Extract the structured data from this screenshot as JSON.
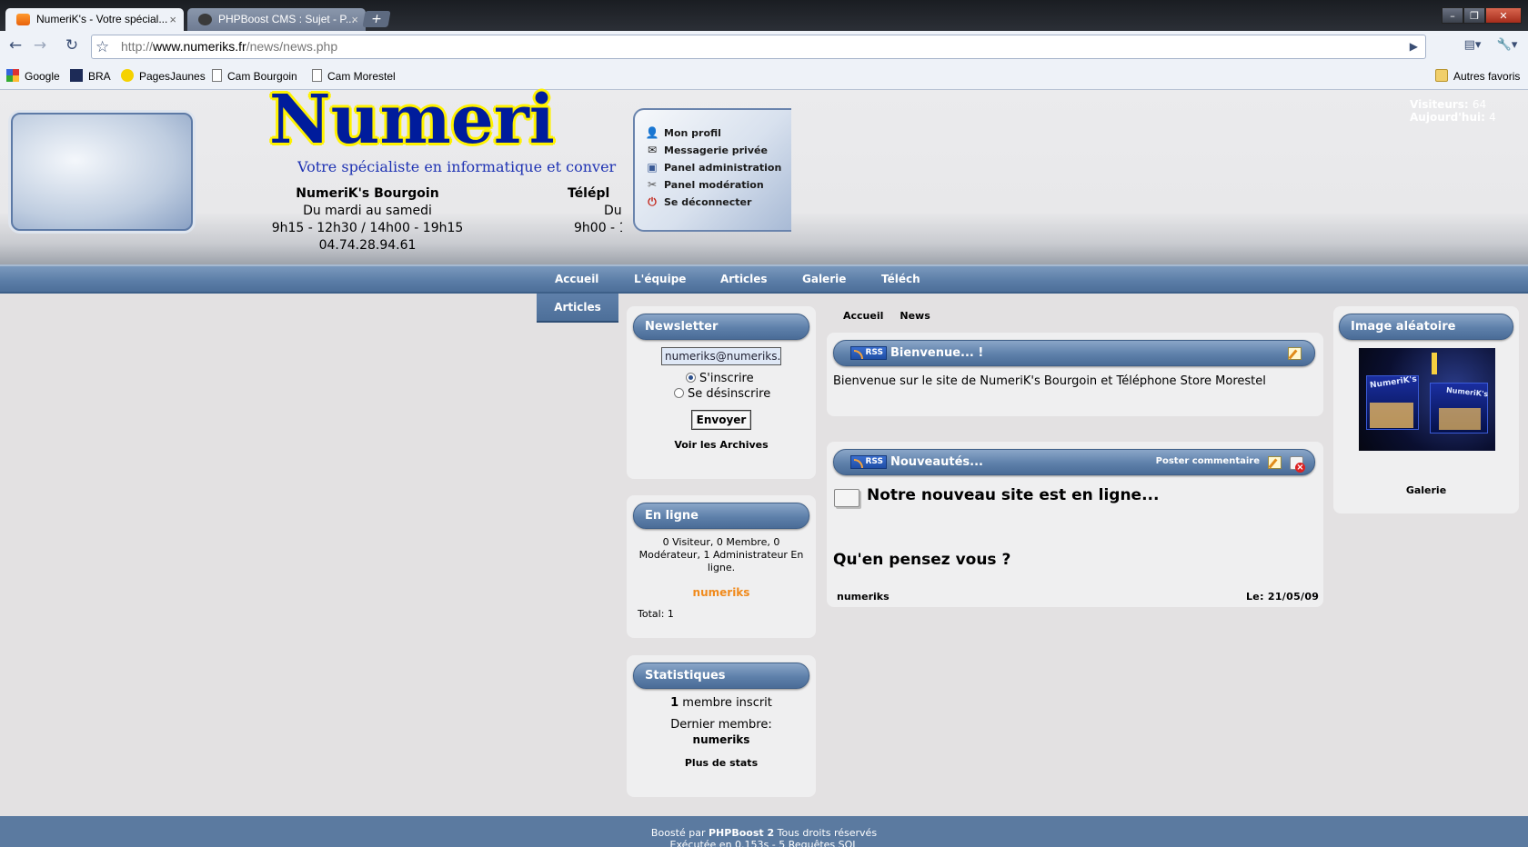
{
  "browser": {
    "tabs": [
      {
        "label": "NumeriK's - Votre spécial...",
        "close": "×",
        "active": true
      },
      {
        "label": "PHPBoost CMS : Sujet - P...",
        "close": "×",
        "active": false
      }
    ],
    "new_tab": "+",
    "window_buttons": {
      "minimize": "–",
      "maximize": "❐",
      "close": "✕"
    },
    "url": {
      "protocol": "http://",
      "domain": "www.numeriks.fr",
      "path": "/news/news.php"
    },
    "nav": {
      "back": "←",
      "forward": "→",
      "reload": "↻",
      "star": "☆",
      "go": "▶",
      "page_menu": "▤▾",
      "tools_menu": "🔧▾"
    },
    "bookmarks": [
      "Google",
      "BRA",
      "PagesJaunes",
      "Cam Bourgoin",
      "Cam Morestel"
    ],
    "other_bookmarks": "Autres favoris"
  },
  "header": {
    "logo_title": "Numeri",
    "logo_tagline": "Votre spécialiste en informatique et conver",
    "shop1": {
      "name": "NumeriK's  Bourgoin",
      "days": "Du mardi au samedi",
      "hours": "9h15 - 12h30  /  14h00 - 19h15",
      "phone": "04.74.28.94.61"
    },
    "shop2": {
      "name": "Télépl",
      "days": "Du",
      "hours": "9h00 - 1"
    },
    "user_menu": [
      {
        "label": "Mon profil",
        "icon": "profile-icon",
        "glyph": "👤"
      },
      {
        "label": "Messagerie privée",
        "icon": "envelope-icon",
        "glyph": "✉"
      },
      {
        "label": "Panel administration",
        "icon": "admin-icon",
        "glyph": "▣"
      },
      {
        "label": "Panel modération",
        "icon": "tools-icon",
        "glyph": "✂"
      },
      {
        "label": "Se déconnecter",
        "icon": "logout-icon",
        "glyph": "⏻"
      }
    ],
    "visitors_label": "Visiteurs:",
    "visitors_value": "64",
    "today_label": "Aujourd'hui:",
    "today_value": "4"
  },
  "nav": {
    "items": [
      "Accueil",
      "L'équipe",
      "Articles",
      "Galerie",
      "Téléch"
    ],
    "submenu": "Articles"
  },
  "newsletter": {
    "title": "Newsletter",
    "email": "numeriks@numeriks.f",
    "subscribe": "S'inscrire",
    "unsubscribe": "Se désinscrire",
    "send": "Envoyer",
    "archives": "Voir les Archives"
  },
  "online": {
    "title": "En ligne",
    "summary": "0 Visiteur, 0 Membre, 0 Modérateur, 1 Administrateur En ligne.",
    "user": "numeriks",
    "total": "Total: 1"
  },
  "stats": {
    "title": "Statistiques",
    "members_count": "1",
    "members_label": "membre inscrit",
    "last_member_label": "Dernier membre:",
    "last_member": "numeriks",
    "more": "Plus de stats"
  },
  "breadcrumb": [
    "Accueil",
    "News"
  ],
  "welcome": {
    "rss": "RSS",
    "title": "Bienvenue... !",
    "text": "Bienvenue sur le site de NumeriK's Bourgoin et Téléphone Store Morestel"
  },
  "news": {
    "rss": "RSS",
    "title": "Nouveautés...",
    "post_comment": "Poster commentaire",
    "headline": "Notre nouveau site est en ligne...",
    "question": "Qu'en pensez vous ?",
    "author": "numeriks",
    "date": "Le: 21/05/09"
  },
  "random_image": {
    "title": "Image aléatoire",
    "link": "Galerie",
    "sign1": "NumeriK's",
    "sign2": "NumeriK's"
  },
  "footer": {
    "line1_prefix": "Boosté par",
    "line1_brand": "PHPBoost 2",
    "line1_suffix": "Tous droits réservés",
    "line2": "Exécutée en 0.153s - 5 Requêtes SQL"
  },
  "colors": {
    "accent": "#5e80aa",
    "logo_blue": "#001c9c",
    "logo_yellow": "#fff200",
    "online_user": "#f08a1c"
  }
}
